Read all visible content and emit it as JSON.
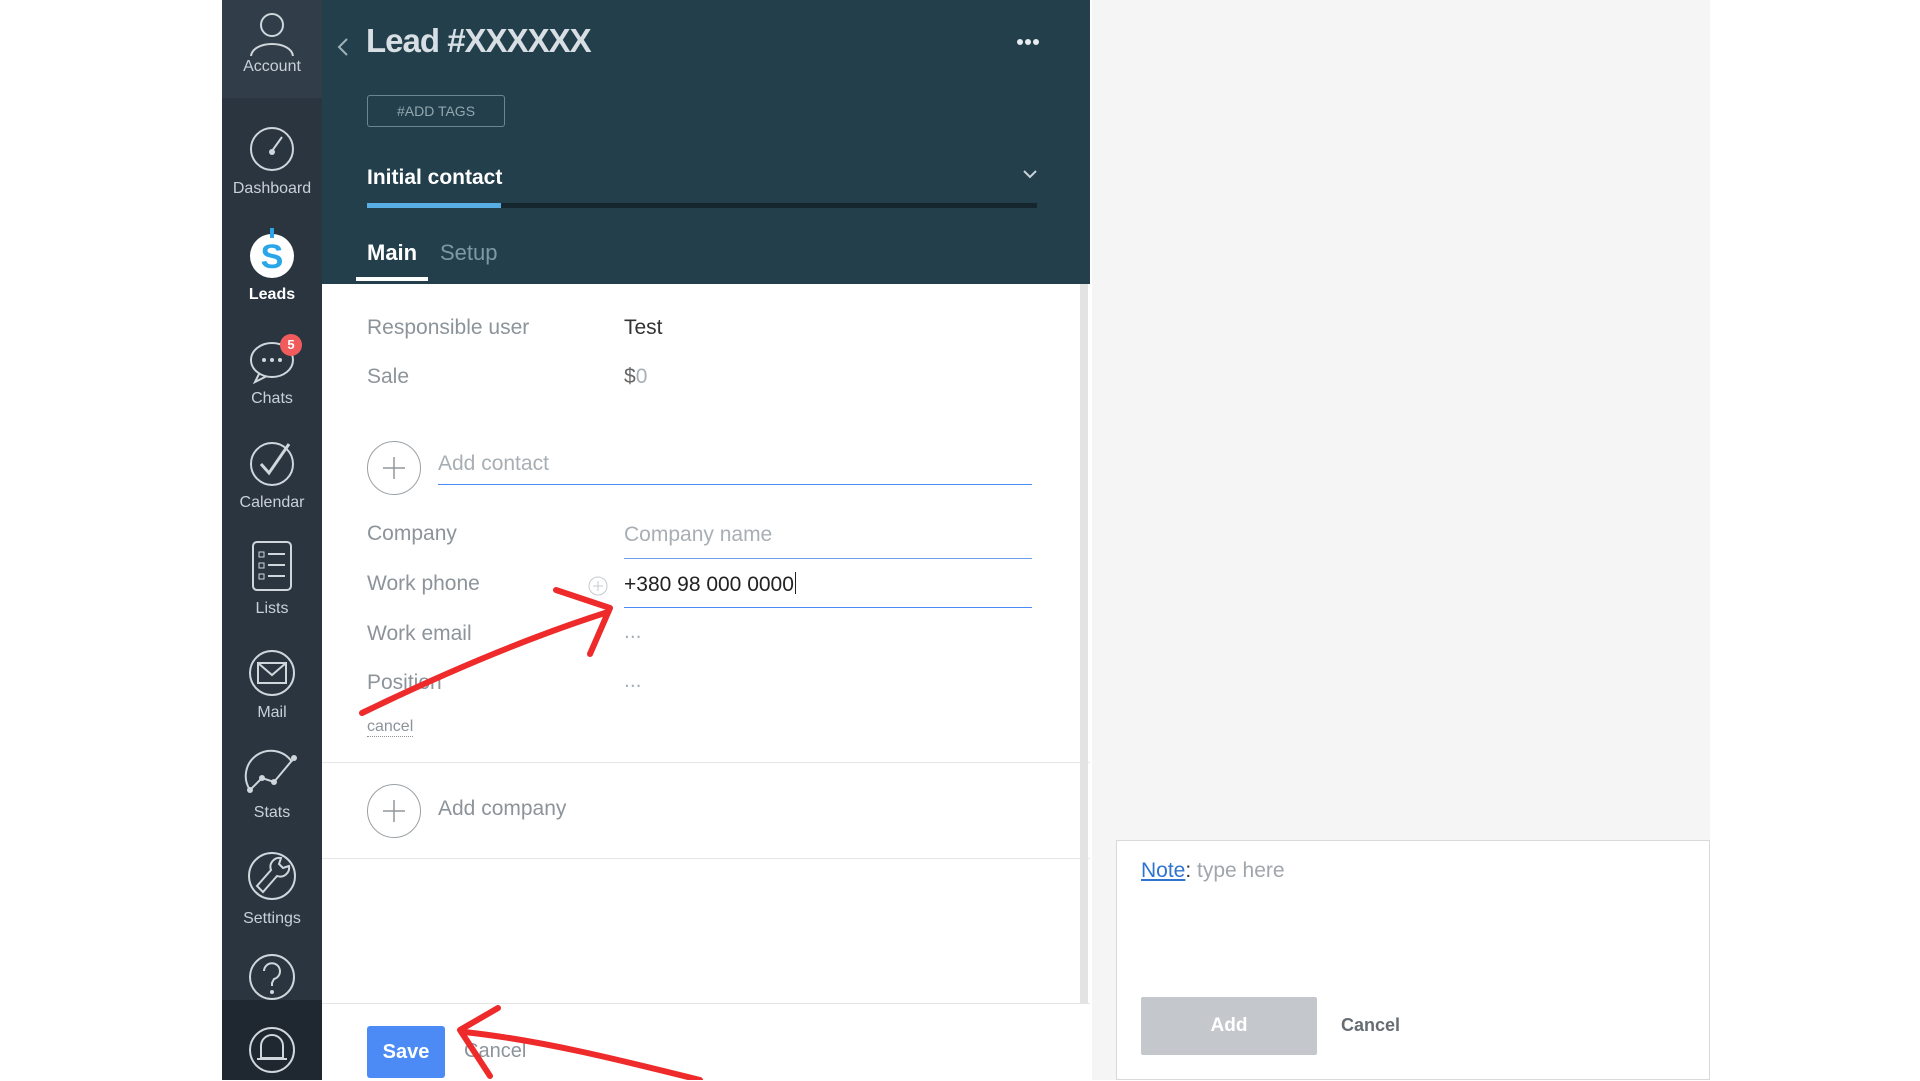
{
  "sidebar": {
    "items": [
      {
        "label": "Account",
        "icon": "user-icon"
      },
      {
        "label": "Dashboard",
        "icon": "speedometer-icon"
      },
      {
        "label": "Leads",
        "icon": "dollar-icon",
        "active": true
      },
      {
        "label": "Chats",
        "icon": "chat-icon",
        "badge": "5"
      },
      {
        "label": "Calendar",
        "icon": "check-circle-icon"
      },
      {
        "label": "Lists",
        "icon": "list-icon"
      },
      {
        "label": "Mail",
        "icon": "mail-icon"
      },
      {
        "label": "Stats",
        "icon": "stats-icon"
      },
      {
        "label": "Settings",
        "icon": "wrench-icon"
      },
      {
        "label": "",
        "icon": "help-icon"
      },
      {
        "label": "",
        "icon": "bell-icon"
      }
    ]
  },
  "lead": {
    "title": "Lead #XXXXXX",
    "tags_button": "#ADD TAGS",
    "stage": "Initial contact",
    "stage_progress": 0.2,
    "tabs": [
      "Main",
      "Setup"
    ],
    "active_tab": "Main"
  },
  "fields": {
    "responsible_label": "Responsible user",
    "responsible_value": "Test",
    "sale_label": "Sale",
    "sale_currency": "$",
    "sale_value": "0"
  },
  "contact": {
    "add_contact_placeholder": "Add contact",
    "company_label": "Company",
    "company_placeholder": "Company name",
    "phone_label": "Work phone",
    "phone_value": "+380 98 000 0000",
    "email_label": "Work email",
    "email_value": "...",
    "position_label": "Position",
    "position_value": "...",
    "cancel_link": "cancel"
  },
  "company": {
    "add_company_label": "Add company"
  },
  "footer": {
    "save_label": "Save",
    "cancel_label": "Cancel"
  },
  "note": {
    "label": "Note",
    "placeholder": "type here",
    "add_label": "Add",
    "cancel_label": "Cancel"
  },
  "colors": {
    "sidebar_bg": "#2a3540",
    "header_bg": "#233f4b",
    "accent": "#4c8bf5",
    "stage_bar": "#5aaee6",
    "badge": "#f25b5b",
    "annotation": "#ee2a2a"
  }
}
